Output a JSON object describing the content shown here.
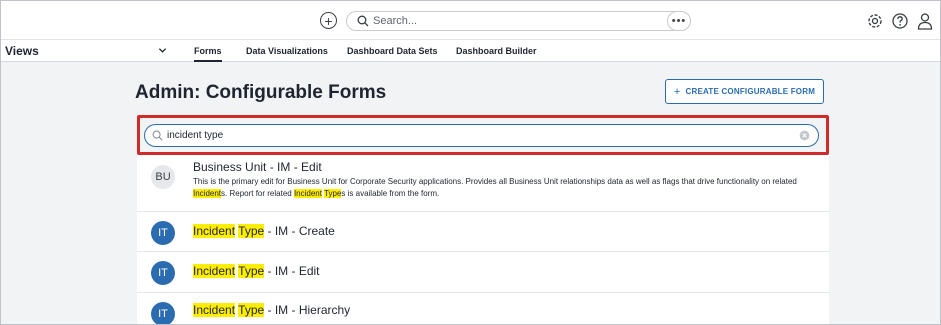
{
  "topbar": {
    "search_placeholder": "Search...",
    "more_label": "•••",
    "add_label": "+"
  },
  "nav": {
    "views_label": "Views",
    "tabs": [
      {
        "label": "Forms",
        "active": true
      },
      {
        "label": "Data Visualizations",
        "active": false
      },
      {
        "label": "Dashboard Data Sets",
        "active": false
      },
      {
        "label": "Dashboard Builder",
        "active": false
      }
    ]
  },
  "page": {
    "title": "Admin: Configurable Forms",
    "create_button_label": "CREATE CONFIGURABLE FORM",
    "create_button_icon": "+"
  },
  "filter": {
    "value": "incident type"
  },
  "results": [
    {
      "avatar": "BU",
      "title": "Business Unit - IM - Edit",
      "desc_parts": [
        "This is the primary edit for Business Unit for Corporate Security applications. Provides all Business Unit relationships data as well as flags that drive functionality on related ",
        "Incident",
        "s. Report for related ",
        "Incident",
        " ",
        "Type",
        "s is available from the form."
      ]
    },
    {
      "avatar": "IT",
      "title_parts": [
        "Incident",
        " ",
        "Type",
        " - IM - Create"
      ]
    },
    {
      "avatar": "IT",
      "title_parts": [
        "Incident",
        " ",
        "Type",
        " - IM - Edit"
      ]
    },
    {
      "avatar": "IT",
      "title_parts": [
        "Incident",
        " ",
        "Type",
        " - IM - Hierarchy"
      ]
    }
  ],
  "colors": {
    "accent": "#2b6cb0",
    "highlight": "#ffee00",
    "callout": "#d02b2b"
  }
}
